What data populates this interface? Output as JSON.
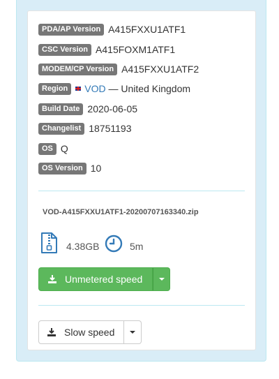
{
  "firmware": {
    "rows": [
      {
        "label": "PDA/AP Version",
        "value": "A415FXXU1ATF1"
      },
      {
        "label": "CSC Version",
        "value": "A415FOXM1ATF1"
      },
      {
        "label": "MODEM/CP Version",
        "value": "A415FXXU1ATF2"
      },
      {
        "label": "Region",
        "link": "VOD",
        "suffix": " — United Kingdom"
      },
      {
        "label": "Build Date",
        "value": "2020-06-05"
      },
      {
        "label": "Changelist",
        "value": "18751193"
      },
      {
        "label": "OS",
        "value": "Q"
      },
      {
        "label": "OS Version",
        "value": "10"
      }
    ]
  },
  "download": {
    "filename": "VOD-A415FXXU1ATF1-20200707163340.zip",
    "size": "4.38GB",
    "time": "5m",
    "unmetered_label": "Unmetered speed",
    "slow_label": "Slow speed"
  },
  "colors": {
    "panel_bg": "#d9edf7",
    "label_bg": "#777777",
    "success": "#5cb85c",
    "link": "#337ab7",
    "icon_blue": "#337ab7"
  },
  "icons": [
    "flag-uk-icon",
    "zip-file-icon",
    "clock-icon",
    "download-icon",
    "caret-down-icon"
  ]
}
